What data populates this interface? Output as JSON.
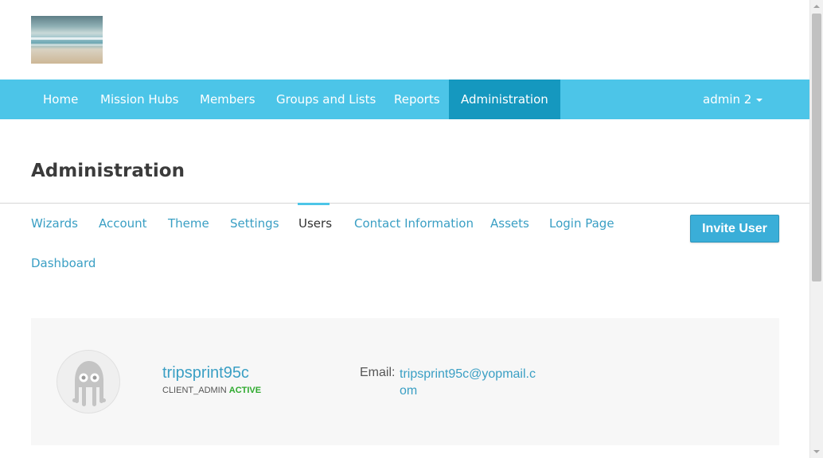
{
  "logo": {
    "icon": "beach-logo-image"
  },
  "navbar": {
    "items": [
      {
        "label": "Home"
      },
      {
        "label": "Mission Hubs"
      },
      {
        "label": "Members"
      },
      {
        "label": "Groups and Lists"
      },
      {
        "label": "Reports"
      },
      {
        "label": "Administration",
        "active": true
      }
    ],
    "user_menu": {
      "label": "admin 2",
      "icon": "caret-down-icon"
    },
    "color": "#4cc5e8",
    "active_color": "#1598bf"
  },
  "page": {
    "title": "Administration"
  },
  "tabs": {
    "items": [
      {
        "label": "Wizards"
      },
      {
        "label": "Account"
      },
      {
        "label": "Theme"
      },
      {
        "label": "Settings"
      },
      {
        "label": "Users",
        "active": true
      },
      {
        "label": "Contact Information"
      },
      {
        "label": "Assets"
      },
      {
        "label": "Login Page"
      },
      {
        "label": "Dashboard"
      }
    ],
    "link_color": "#3a9fc4"
  },
  "actions": {
    "invite_label": "Invite User"
  },
  "users": [
    {
      "username": "tripsprint95c",
      "role": "CLIENT_ADMIN",
      "status": "ACTIVE",
      "email_label": "Email:",
      "email": "tripsprint95c@yopmail.com",
      "avatar_icon": "octopus-avatar-icon"
    }
  ]
}
